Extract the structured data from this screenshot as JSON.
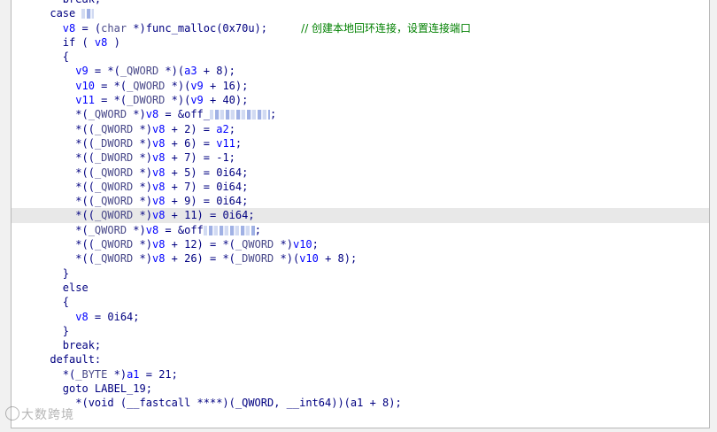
{
  "code": {
    "lines": [
      {
        "indent": "    ",
        "segments": [
          {
            "t": "break;",
            "c": "kw"
          }
        ]
      },
      {
        "indent": "  ",
        "segments": [
          {
            "t": "case ",
            "c": "kw"
          },
          {
            "redact": 14
          }
        ]
      },
      {
        "indent": "    ",
        "segments": [
          {
            "t": "v8",
            "c": "var"
          },
          {
            "t": " = (",
            "c": "plain"
          },
          {
            "t": "char",
            "c": "type"
          },
          {
            "t": " *)func_malloc(0x70u);",
            "c": "plain"
          },
          {
            "t": "          // 创建本地回环连接，设置连接端口",
            "c": "cmt"
          }
        ]
      },
      {
        "indent": "    ",
        "segments": [
          {
            "t": "if ( ",
            "c": "kw"
          },
          {
            "t": "v8",
            "c": "var"
          },
          {
            "t": " )",
            "c": "plain"
          }
        ]
      },
      {
        "indent": "    ",
        "segments": [
          {
            "t": "{",
            "c": "plain"
          }
        ]
      },
      {
        "indent": "      ",
        "segments": [
          {
            "t": "v9",
            "c": "var"
          },
          {
            "t": " = *(",
            "c": "plain"
          },
          {
            "t": "_QWORD",
            "c": "type"
          },
          {
            "t": " *)(",
            "c": "plain"
          },
          {
            "t": "a3",
            "c": "var"
          },
          {
            "t": " + 8);",
            "c": "plain"
          }
        ]
      },
      {
        "indent": "      ",
        "segments": [
          {
            "t": "v10",
            "c": "var"
          },
          {
            "t": " = *(",
            "c": "plain"
          },
          {
            "t": "_QWORD",
            "c": "type"
          },
          {
            "t": " *)(",
            "c": "plain"
          },
          {
            "t": "v9",
            "c": "var"
          },
          {
            "t": " + 16);",
            "c": "plain"
          }
        ]
      },
      {
        "indent": "      ",
        "segments": [
          {
            "t": "v11",
            "c": "var"
          },
          {
            "t": " = *(",
            "c": "plain"
          },
          {
            "t": "_DWORD",
            "c": "type"
          },
          {
            "t": " *)(",
            "c": "plain"
          },
          {
            "t": "v9",
            "c": "var"
          },
          {
            "t": " + 40);",
            "c": "plain"
          }
        ]
      },
      {
        "indent": "      ",
        "segments": [
          {
            "t": "*(",
            "c": "plain"
          },
          {
            "t": "_QWORD",
            "c": "type"
          },
          {
            "t": " *)",
            "c": "plain"
          },
          {
            "t": "v8",
            "c": "var"
          },
          {
            "t": " = &off_",
            "c": "plain"
          },
          {
            "redact": 68
          },
          {
            "t": ";",
            "c": "plain"
          }
        ]
      },
      {
        "indent": "      ",
        "segments": [
          {
            "t": "*((",
            "c": "plain"
          },
          {
            "t": "_QWORD",
            "c": "type"
          },
          {
            "t": " *)",
            "c": "plain"
          },
          {
            "t": "v8",
            "c": "var"
          },
          {
            "t": " + 2) = ",
            "c": "plain"
          },
          {
            "t": "a2",
            "c": "var"
          },
          {
            "t": ";",
            "c": "plain"
          }
        ]
      },
      {
        "indent": "      ",
        "segments": [
          {
            "t": "*((",
            "c": "plain"
          },
          {
            "t": "_DWORD",
            "c": "type"
          },
          {
            "t": " *)",
            "c": "plain"
          },
          {
            "t": "v8",
            "c": "var"
          },
          {
            "t": " + 6) = ",
            "c": "plain"
          },
          {
            "t": "v11",
            "c": "var"
          },
          {
            "t": ";",
            "c": "plain"
          }
        ]
      },
      {
        "indent": "      ",
        "segments": [
          {
            "t": "*((",
            "c": "plain"
          },
          {
            "t": "_DWORD",
            "c": "type"
          },
          {
            "t": " *)",
            "c": "plain"
          },
          {
            "t": "v8",
            "c": "var"
          },
          {
            "t": " + 7) = -1;",
            "c": "plain"
          }
        ]
      },
      {
        "indent": "      ",
        "segments": [
          {
            "t": "*((",
            "c": "plain"
          },
          {
            "t": "_QWORD",
            "c": "type"
          },
          {
            "t": " *)",
            "c": "plain"
          },
          {
            "t": "v8",
            "c": "var"
          },
          {
            "t": " + 5) = 0i64;",
            "c": "plain"
          }
        ]
      },
      {
        "indent": "      ",
        "segments": [
          {
            "t": "*((",
            "c": "plain"
          },
          {
            "t": "_QWORD",
            "c": "type"
          },
          {
            "t": " *)",
            "c": "plain"
          },
          {
            "t": "v8",
            "c": "var"
          },
          {
            "t": " + 7) = 0i64;",
            "c": "plain"
          }
        ]
      },
      {
        "indent": "      ",
        "segments": [
          {
            "t": "*((",
            "c": "plain"
          },
          {
            "t": "_QWORD",
            "c": "type"
          },
          {
            "t": " *)",
            "c": "plain"
          },
          {
            "t": "v8",
            "c": "var"
          },
          {
            "t": " + 9) = 0i64;",
            "c": "plain"
          }
        ]
      },
      {
        "indent": "      ",
        "highlight": true,
        "segments": [
          {
            "t": "*((",
            "c": "plain"
          },
          {
            "t": "_QWORD",
            "c": "type"
          },
          {
            "t": " *)",
            "c": "plain"
          },
          {
            "t": "v8",
            "c": "var"
          },
          {
            "t": " + 11) = 0i64;",
            "c": "plain"
          }
        ]
      },
      {
        "indent": "      ",
        "segments": [
          {
            "t": "*(",
            "c": "plain"
          },
          {
            "t": "_QWORD",
            "c": "type"
          },
          {
            "t": " *)",
            "c": "plain"
          },
          {
            "t": "v8",
            "c": "var"
          },
          {
            "t": " = &off",
            "c": "plain"
          },
          {
            "redact": 58
          },
          {
            "t": ";",
            "c": "plain"
          }
        ]
      },
      {
        "indent": "      ",
        "segments": [
          {
            "t": "*((",
            "c": "plain"
          },
          {
            "t": "_QWORD",
            "c": "type"
          },
          {
            "t": " *)",
            "c": "plain"
          },
          {
            "t": "v8",
            "c": "var"
          },
          {
            "t": " + 12) = *(",
            "c": "plain"
          },
          {
            "t": "_QWORD",
            "c": "type"
          },
          {
            "t": " *)",
            "c": "plain"
          },
          {
            "t": "v10",
            "c": "var"
          },
          {
            "t": ";",
            "c": "plain"
          }
        ]
      },
      {
        "indent": "      ",
        "segments": [
          {
            "t": "*((",
            "c": "plain"
          },
          {
            "t": "_QWORD",
            "c": "type"
          },
          {
            "t": " *)",
            "c": "plain"
          },
          {
            "t": "v8",
            "c": "var"
          },
          {
            "t": " + 26) = *(",
            "c": "plain"
          },
          {
            "t": "_DWORD",
            "c": "type"
          },
          {
            "t": " *)(",
            "c": "plain"
          },
          {
            "t": "v10",
            "c": "var"
          },
          {
            "t": " + 8);",
            "c": "plain"
          }
        ]
      },
      {
        "indent": "    ",
        "segments": [
          {
            "t": "}",
            "c": "plain"
          }
        ]
      },
      {
        "indent": "    ",
        "segments": [
          {
            "t": "else",
            "c": "kw"
          }
        ]
      },
      {
        "indent": "    ",
        "segments": [
          {
            "t": "{",
            "c": "plain"
          }
        ]
      },
      {
        "indent": "      ",
        "segments": [
          {
            "t": "v8",
            "c": "var"
          },
          {
            "t": " = 0i64;",
            "c": "plain"
          }
        ]
      },
      {
        "indent": "    ",
        "segments": [
          {
            "t": "}",
            "c": "plain"
          }
        ]
      },
      {
        "indent": "    ",
        "segments": [
          {
            "t": "break;",
            "c": "kw"
          }
        ]
      },
      {
        "indent": "  ",
        "segments": [
          {
            "t": "default:",
            "c": "kw"
          }
        ]
      },
      {
        "indent": "    ",
        "segments": [
          {
            "t": "*(",
            "c": "plain"
          },
          {
            "t": "_BYTE",
            "c": "type"
          },
          {
            "t": " *)",
            "c": "plain"
          },
          {
            "t": "a1",
            "c": "var"
          },
          {
            "t": " = 21;",
            "c": "plain"
          }
        ]
      },
      {
        "indent": "    ",
        "segments": [
          {
            "t": "goto LABEL_19;",
            "c": "kw"
          }
        ]
      },
      {
        "indent": "      ",
        "segments": [
          {
            "t": "*(void (__fastcall ****)(_QWORD, __int64))(a1 + 8);",
            "c": "plain"
          }
        ]
      }
    ]
  },
  "watermark": {
    "text": "大数跨境"
  },
  "colors": {
    "keyword": "#000080",
    "variable": "#0000ff",
    "comment": "#008000",
    "highlight_row": "#e8e8e8"
  }
}
